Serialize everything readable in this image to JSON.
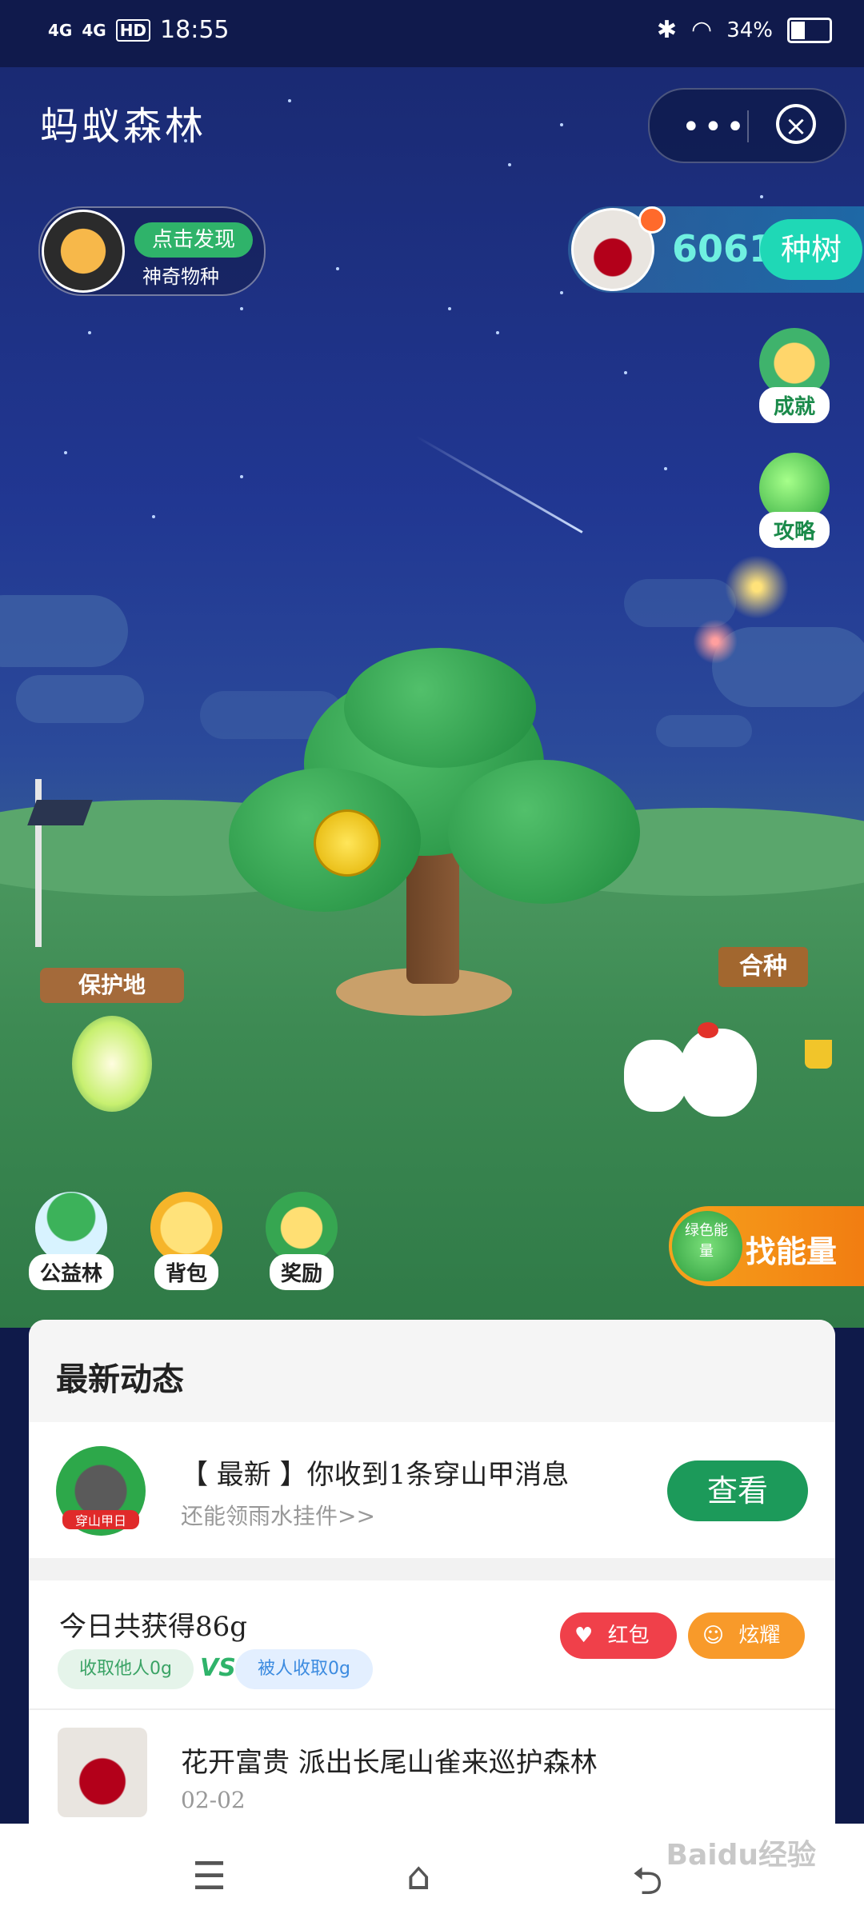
{
  "status_bar": {
    "signal1": "4G",
    "signal2": "4G",
    "hd": "HD",
    "time": "18:55",
    "battery": "34%"
  },
  "header": {
    "title": "蚂蚁森林",
    "menu_icon": "more-dots-icon",
    "close_icon": "close-circle-icon"
  },
  "discover": {
    "button": "点击发现",
    "subtitle": "神奇物种"
  },
  "energy": {
    "value": "6061g",
    "plant_button": "种树"
  },
  "side_buttons": [
    {
      "label": "成就",
      "icon": "achievement-icon"
    },
    {
      "label": "攻略",
      "icon": "guide-icon"
    }
  ],
  "scene": {
    "protect_sign": "保护地",
    "cooperate_sign": "合种"
  },
  "quick_buttons": [
    {
      "label": "公益林",
      "icon": "forest-icon"
    },
    {
      "label": "背包",
      "icon": "backpack-icon"
    },
    {
      "label": "奖励",
      "icon": "reward-icon"
    }
  ],
  "find_energy": {
    "badge": "绿色能量",
    "label": "找能量"
  },
  "panel": {
    "title": "最新动态",
    "notice": {
      "avatar_tag": "穿山甲日",
      "title": "【 最新 】你收到1条穿山甲消息",
      "subtitle": "还能领雨水挂件>>",
      "button": "查看"
    },
    "today": {
      "title": "今日共获得86g",
      "collect_others": "收取他人0g",
      "vs": "VS",
      "collected_by": "被人收取0g",
      "redpacket": "红包",
      "share": "炫耀"
    },
    "feed": {
      "text": "花开富贵 派出长尾山雀来巡护森林",
      "date": "02-02"
    }
  },
  "navbar": {
    "menu": "☰",
    "home": "⌂",
    "back": "⮌"
  },
  "watermark": "Baidu经验"
}
